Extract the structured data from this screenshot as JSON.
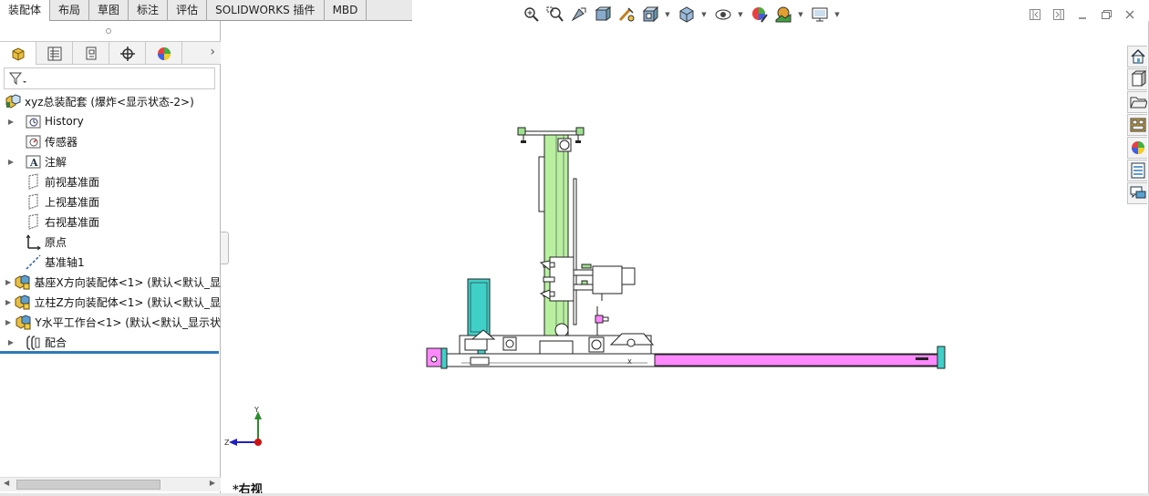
{
  "tabs": [
    "装配体",
    "布局",
    "草图",
    "标注",
    "评估",
    "SOLIDWORKS 插件",
    "MBD"
  ],
  "active_tab": "装配体",
  "hud_icons": [
    {
      "name": "zoom-to-fit-icon",
      "dropdown": false
    },
    {
      "name": "zoom-to-area-icon",
      "dropdown": false
    },
    {
      "name": "previous-view-icon",
      "dropdown": false
    },
    {
      "name": "section-view-icon",
      "dropdown": false
    },
    {
      "name": "dynamic-annotation-icon",
      "dropdown": false
    },
    {
      "name": "view-orientation-icon",
      "dropdown": true
    },
    {
      "name": "display-style-icon",
      "dropdown": true
    },
    {
      "name": "hide-show-items-icon",
      "dropdown": true
    },
    {
      "name": "edit-appearance-icon",
      "dropdown": false
    },
    {
      "name": "apply-scene-icon",
      "dropdown": true
    },
    {
      "name": "view-settings-icon",
      "dropdown": true
    }
  ],
  "feature_tree": [
    {
      "label": "xyz总装配套 (爆炸<显示状态-2>)",
      "icon": "assembly-icon",
      "expander": false,
      "indent": 0
    },
    {
      "label": "History",
      "icon": "history-icon",
      "expander": true,
      "indent": 1
    },
    {
      "label": "传感器",
      "icon": "sensor-icon",
      "expander": false,
      "indent": 1
    },
    {
      "label": "注解",
      "icon": "annotations-icon",
      "expander": true,
      "indent": 1
    },
    {
      "label": "前视基准面",
      "icon": "plane-icon",
      "expander": false,
      "indent": 1
    },
    {
      "label": "上视基准面",
      "icon": "plane-icon",
      "expander": false,
      "indent": 1
    },
    {
      "label": "右视基准面",
      "icon": "plane-icon",
      "expander": false,
      "indent": 1
    },
    {
      "label": "原点",
      "icon": "origin-icon",
      "expander": false,
      "indent": 1
    },
    {
      "label": "基准轴1",
      "icon": "axis-icon",
      "expander": false,
      "indent": 1
    },
    {
      "label": "基座X方向装配体<1> (默认<默认_显",
      "icon": "subassembly-icon",
      "expander": true,
      "indent": 1
    },
    {
      "label": "立柱Z方向装配体<1> (默认<默认_显",
      "icon": "subassembly-icon",
      "expander": true,
      "indent": 1
    },
    {
      "label": "Y水平工作台<1> (默认<默认_显示状",
      "icon": "subassembly-icon",
      "expander": true,
      "indent": 1
    },
    {
      "label": "配合",
      "icon": "mates-icon",
      "expander": true,
      "indent": 1
    }
  ],
  "fm_tabs": [
    "featuremanager-icon",
    "propertymanager-icon",
    "configurationmanager-icon",
    "dimxpert-icon",
    "display-manager-icon"
  ],
  "task_pane": [
    "home-icon",
    "design-library-icon",
    "file-explorer-icon",
    "view-palette-icon",
    "appearances-icon",
    "custom-properties-icon",
    "forum-icon"
  ],
  "triad": {
    "y": "Y",
    "z": "Z"
  },
  "view_label": "*右视",
  "colors": {
    "column": "#b8f0a0",
    "rail": "#ff88ff",
    "block": "#40d0c8",
    "accent": "#2e7ab8"
  }
}
